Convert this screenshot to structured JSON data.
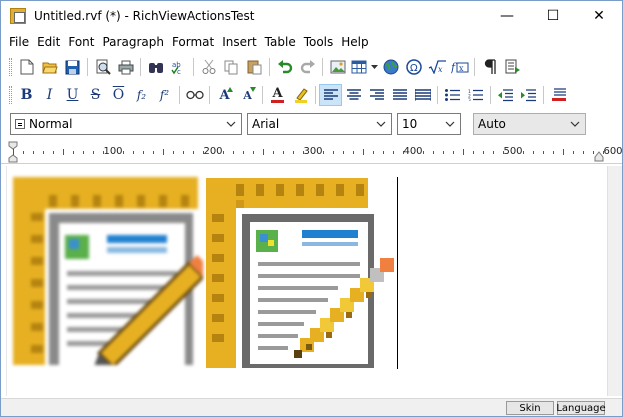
{
  "window": {
    "title": "Untitled.rvf (*) - RichViewActionsTest",
    "minimize": "—",
    "maximize": "☐",
    "close": "✕"
  },
  "menu": [
    "File",
    "Edit",
    "Font",
    "Paragraph",
    "Format",
    "Insert",
    "Table",
    "Tools",
    "Help"
  ],
  "format_toolbar": {
    "bold": "B",
    "italic": "I",
    "underline": "U",
    "strike": "S",
    "overline": "O",
    "subscript": "f₂",
    "superscript": "f²",
    "grow_font": "A",
    "shrink_font": "A",
    "font_color": "A"
  },
  "combos": {
    "style": "Normal",
    "font": "Arial",
    "size": "10",
    "color": "Auto"
  },
  "ruler": {
    "labels": [
      "100",
      "200",
      "300",
      "400",
      "500",
      "600"
    ]
  },
  "status": {
    "skin": "Skin",
    "language": "Language"
  },
  "colors": {
    "accent_frame": "#e0b030",
    "active_button": "#cce4f7",
    "window_border": "#7a9cc8"
  }
}
